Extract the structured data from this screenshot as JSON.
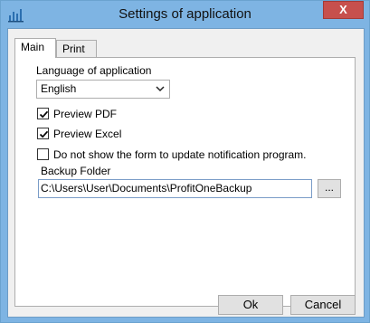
{
  "window": {
    "title": "Settings of application",
    "close_symbol": "X"
  },
  "tabs": [
    {
      "label": "Main"
    },
    {
      "label": "Print"
    }
  ],
  "main": {
    "language_label": "Language of application",
    "language_value": "English",
    "preview_pdf": {
      "label": "Preview PDF",
      "checked": true
    },
    "preview_excel": {
      "label": "Preview Excel",
      "checked": true
    },
    "no_update_form": {
      "label": "Do not show the form to update notification program.",
      "checked": false
    },
    "backup_label": "Backup Folder",
    "backup_value": "C:\\Users\\User\\Documents\\ProfitOneBackup",
    "browse_label": "..."
  },
  "buttons": {
    "ok": "Ok",
    "cancel": "Cancel"
  },
  "icons": [
    "app-chart-icon",
    "close-icon",
    "chevron-down-icon",
    "checkmark-icon"
  ],
  "colors": {
    "frame": "#7eb4e3",
    "close": "#c7504d",
    "panel": "#f0f0f0"
  }
}
